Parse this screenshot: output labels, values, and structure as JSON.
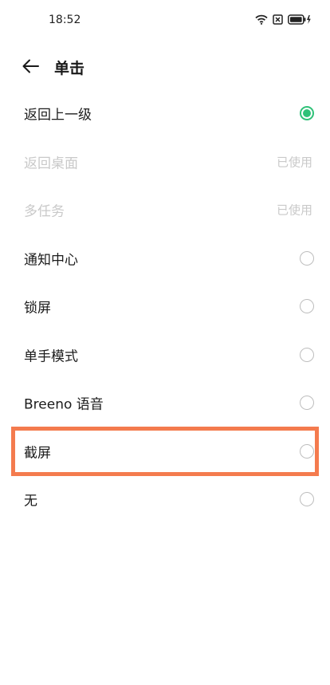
{
  "status": {
    "time": "18:52"
  },
  "header": {
    "title": "单击"
  },
  "options": [
    {
      "label": "返回上一级",
      "state": "selected"
    },
    {
      "label": "返回桌面",
      "state": "used",
      "note": "已使用"
    },
    {
      "label": "多任务",
      "state": "used",
      "note": "已使用"
    },
    {
      "label": "通知中心",
      "state": "unselected"
    },
    {
      "label": "锁屏",
      "state": "unselected"
    },
    {
      "label": "单手模式",
      "state": "unselected"
    },
    {
      "label": "Breeno 语音",
      "state": "unselected"
    },
    {
      "label": "截屏",
      "state": "unselected"
    },
    {
      "label": "无",
      "state": "unselected"
    }
  ],
  "colors": {
    "accent": "#2fc178",
    "highlight": "#f47b4e"
  }
}
